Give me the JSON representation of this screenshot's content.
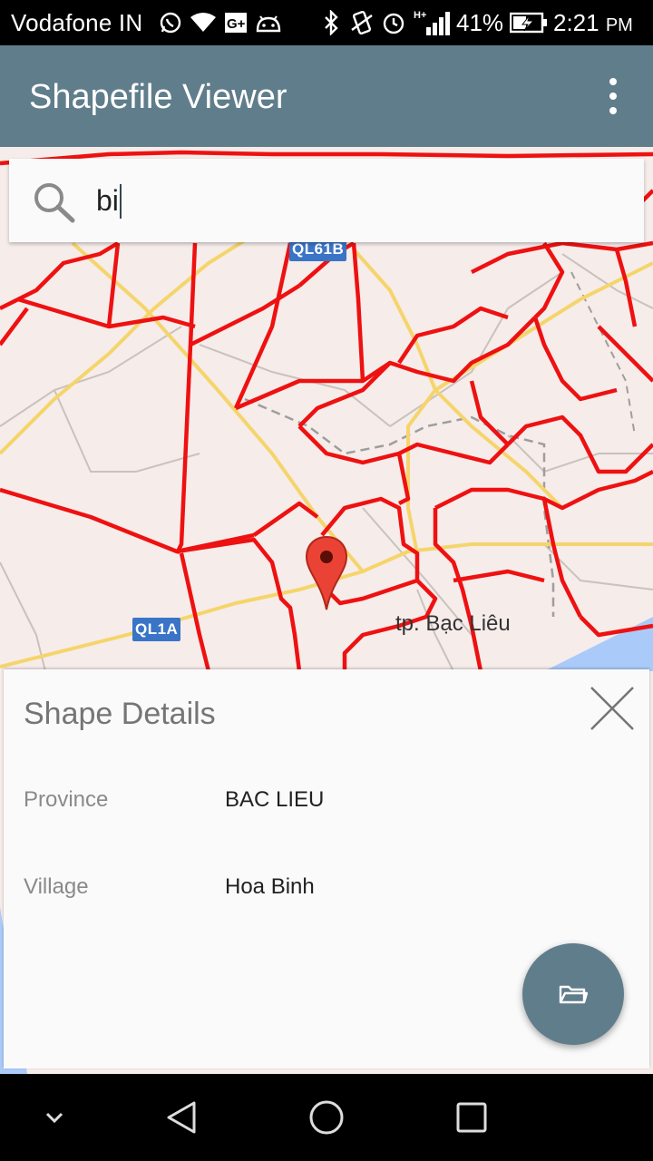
{
  "status_bar": {
    "carrier": "Vodafone IN",
    "battery_percent": "41%",
    "time": "2:21",
    "time_suffix": "PM",
    "network_type": "H+",
    "icons": [
      "whatsapp-icon",
      "wifi-icon",
      "google-plus-icon",
      "android-icon",
      "bluetooth-icon",
      "vibrate-icon",
      "alarm-icon",
      "signal-icon",
      "battery-charging-icon"
    ]
  },
  "app_bar": {
    "title": "Shapefile Viewer",
    "menu_icon": "more-vert-icon"
  },
  "search": {
    "value": "bi",
    "icon": "search-icon"
  },
  "map": {
    "road_shields": [
      "QL61B",
      "QL1A"
    ],
    "place_label": "tp. Bạc Liêu",
    "marker_icon": "map-pin-icon",
    "boundary_color": "#ff0000",
    "road_color": "#f5d56b",
    "water_color": "#aacbf9"
  },
  "details": {
    "title": "Shape Details",
    "close_icon": "close-icon",
    "rows": [
      {
        "label": "Province",
        "value": "BAC LIEU"
      },
      {
        "label": "Village",
        "value": "Hoa Binh"
      }
    ]
  },
  "fab": {
    "icon": "folder-open-icon",
    "color": "#607d8b"
  },
  "nav_bar": {
    "icons": [
      "hide-keyboard-icon",
      "back-icon",
      "home-icon",
      "recents-icon"
    ]
  }
}
